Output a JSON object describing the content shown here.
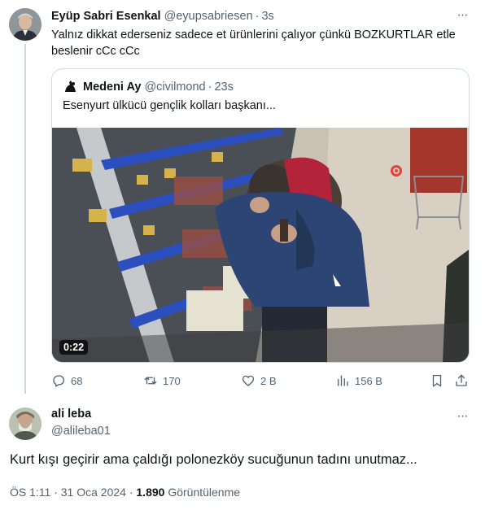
{
  "tweet": {
    "author_name": "Eyüp Sabri Esenkal",
    "author_handle": "@eyupsabriesen",
    "separator": "·",
    "time": "3s",
    "more": "···",
    "text": "Yalnız dikkat ederseniz sadece et ürünlerini çalıyor çünkü BOZKURTLAR etle beslenir cCc cCc",
    "quote": {
      "author_name": "Medeni Ay",
      "author_handle": "@civilmond",
      "time": "23s",
      "text": "Esenyurt ülkücü gençlik kolları başkanı...",
      "video_duration": "0:22"
    },
    "actions": {
      "replies": "68",
      "retweets": "170",
      "likes": "2 B",
      "views": "156 B"
    }
  },
  "reply": {
    "author_name": "ali leba",
    "author_handle": "@alileba01",
    "more": "···",
    "text": "Kurt kışı geçirir ama çaldığı polonezköy sucuğunun tadını unutmaz...",
    "time_date": "ÖS 1:11 · 31 Oca 2024 · ",
    "views_count": "1.890",
    "views_label": " Görüntülenme"
  },
  "icons": {
    "reply": "reply-icon",
    "retweet": "retweet-icon",
    "like": "heart-icon",
    "views": "views-icon",
    "bookmark": "bookmark-icon",
    "share": "share-icon"
  },
  "colors": {
    "text": "#0f1419",
    "secondary": "#536471",
    "border": "#cfd9de"
  }
}
